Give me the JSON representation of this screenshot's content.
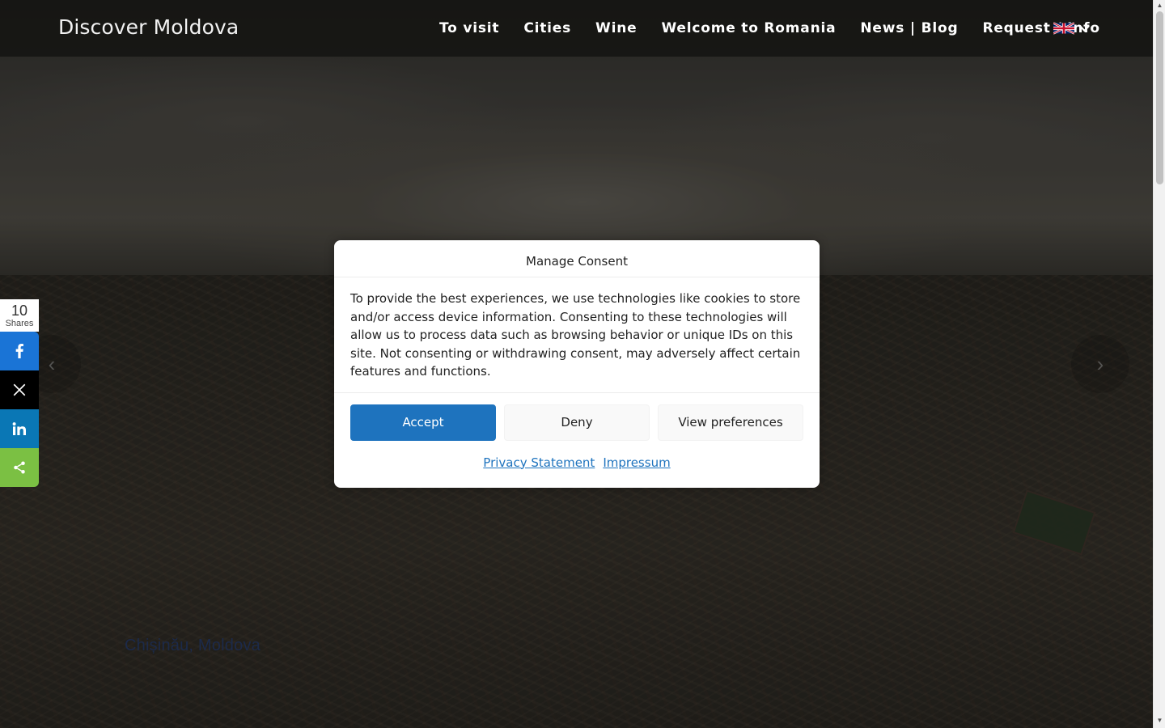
{
  "header": {
    "logo": "Discover Moldova",
    "nav": [
      "To visit",
      "Cities",
      "Wine",
      "Welcome to Romania",
      "News | Blog",
      "Request / Info"
    ],
    "language_icon": "uk-flag-icon"
  },
  "hero": {
    "caption": "Chișinău, Moldova"
  },
  "share": {
    "count": "10",
    "count_label": "Shares",
    "buttons": [
      "facebook-icon",
      "x-icon",
      "linkedin-icon",
      "share-icon"
    ]
  },
  "consent": {
    "title": "Manage Consent",
    "body": "To provide the best experiences, we use technologies like cookies to store and/or access device information. Consenting to these technologies will allow us to process data such as browsing behavior or unique IDs on this site. Not consenting or withdrawing consent, may adversely affect certain features and functions.",
    "accept_label": "Accept",
    "deny_label": "Deny",
    "preferences_label": "View preferences",
    "privacy_link": "Privacy Statement",
    "impressum_link": "Impressum"
  },
  "colors": {
    "accent": "#1e73be",
    "facebook": "#1a74d6",
    "x": "#000000",
    "linkedin": "#0a77b5",
    "share": "#7bc043"
  }
}
